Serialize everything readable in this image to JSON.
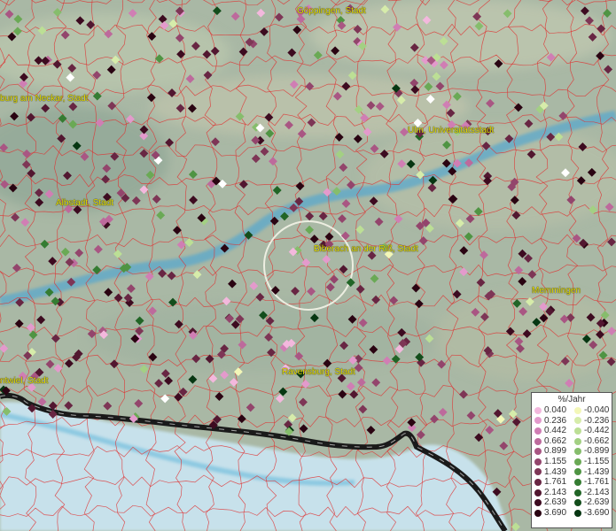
{
  "map": {
    "colors": {
      "terrain": "#a9b8a5",
      "boundary": "#e03030",
      "water": "#5aa8cc",
      "lake": "#c9e4ef",
      "border": "#1a1a1a",
      "label": "#e6e000"
    },
    "cities": [
      {
        "name": "Göppingen, Stadt"
      },
      {
        "name": "burg am Neckar, Stadt"
      },
      {
        "name": "Ulm, Universitätsstadt"
      },
      {
        "name": "Albstadt, Stadt"
      },
      {
        "name": "Biberach an der Riß, Stadt"
      },
      {
        "name": "Memmingen"
      },
      {
        "name": "Ravensburg, Stadt"
      },
      {
        "name": "ntwiel, Stadt"
      }
    ]
  },
  "legend": {
    "title": "%/Jahr",
    "rows": [
      {
        "pos": "0.040",
        "pos_color": "#f3b8dd",
        "neg": "-0.040",
        "neg_color": "#f3f7b8"
      },
      {
        "pos": "0.236",
        "pos_color": "#e39acc",
        "neg": "-0.236",
        "neg_color": "#d6ecaa"
      },
      {
        "pos": "0.442",
        "pos_color": "#d07eb4",
        "neg": "-0.442",
        "neg_color": "#bcdf95"
      },
      {
        "pos": "0.662",
        "pos_color": "#bd6a9c",
        "neg": "-0.662",
        "neg_color": "#a3d083"
      },
      {
        "pos": "0.899",
        "pos_color": "#a95683",
        "neg": "-0.899",
        "neg_color": "#86bd6c"
      },
      {
        "pos": "1.155",
        "pos_color": "#93456c",
        "neg": "-1.155",
        "neg_color": "#6aa955"
      },
      {
        "pos": "1.439",
        "pos_color": "#7e3656",
        "neg": "-1.439",
        "neg_color": "#4f9443"
      },
      {
        "pos": "1.761",
        "pos_color": "#682643",
        "neg": "-1.761",
        "neg_color": "#357c32"
      },
      {
        "pos": "2.143",
        "pos_color": "#521730",
        "neg": "-2.143",
        "neg_color": "#216526"
      },
      {
        "pos": "2.639",
        "pos_color": "#3d0b20",
        "neg": "-2.639",
        "neg_color": "#134d1b"
      },
      {
        "pos": "3.690",
        "pos_color": "#2a0412",
        "neg": "-3.690",
        "neg_color": "#073612"
      }
    ]
  }
}
